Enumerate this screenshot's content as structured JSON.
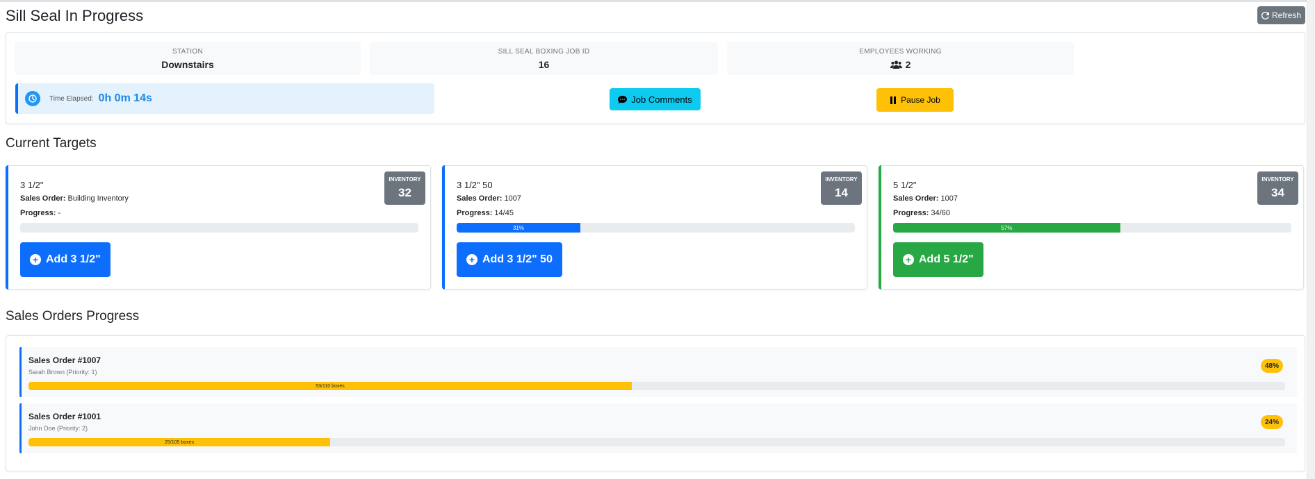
{
  "header": {
    "title": "Sill Seal In Progress",
    "refresh_label": "Refresh"
  },
  "job": {
    "station_label": "STATION",
    "station_value": "Downstairs",
    "job_id_label": "SILL SEAL BOXING JOB ID",
    "job_id_value": "16",
    "employees_label": "EMPLOYEES WORKING",
    "employees_value": "2",
    "time_label": "Time Elapsed:",
    "time_value": "0h 0m 14s",
    "comments_label": "Job Comments",
    "pause_label": "Pause Job"
  },
  "targets": {
    "title": "Current Targets",
    "sales_order_label": "Sales Order:",
    "progress_label": "Progress:",
    "inventory_label": "INVENTORY",
    "items": [
      {
        "name": "3 1/2\"",
        "sales_order": "Building Inventory",
        "progress": "-",
        "progress_fraction": 0,
        "progress_pct_label": "",
        "inventory": "32",
        "button_label": "Add 3 1/2\"",
        "color": "#0d6efd"
      },
      {
        "name": "3 1/2\" 50",
        "sales_order": "1007",
        "progress": "14/45",
        "progress_fraction": 0.31,
        "progress_pct_label": "31%",
        "inventory": "14",
        "button_label": "Add 3 1/2\" 50",
        "color": "#0d6efd"
      },
      {
        "name": "5 1/2\"",
        "sales_order": "1007",
        "progress": "34/60",
        "progress_fraction": 0.57,
        "progress_pct_label": "57%",
        "inventory": "34",
        "button_label": "Add 5 1/2\"",
        "color": "#28a745"
      }
    ]
  },
  "sales_orders": {
    "title": "Sales Orders Progress",
    "items": [
      {
        "title": "Sales Order #1007",
        "subtitle": "Sarah Brown (Priority: 1)",
        "percent": "48%",
        "progress_fraction": 0.48,
        "boxes_label": "53/110 boxes"
      },
      {
        "title": "Sales Order #1001",
        "subtitle": "John Doe (Priority: 2)",
        "percent": "24%",
        "progress_fraction": 0.24,
        "boxes_label": "25/105 boxes"
      }
    ]
  }
}
